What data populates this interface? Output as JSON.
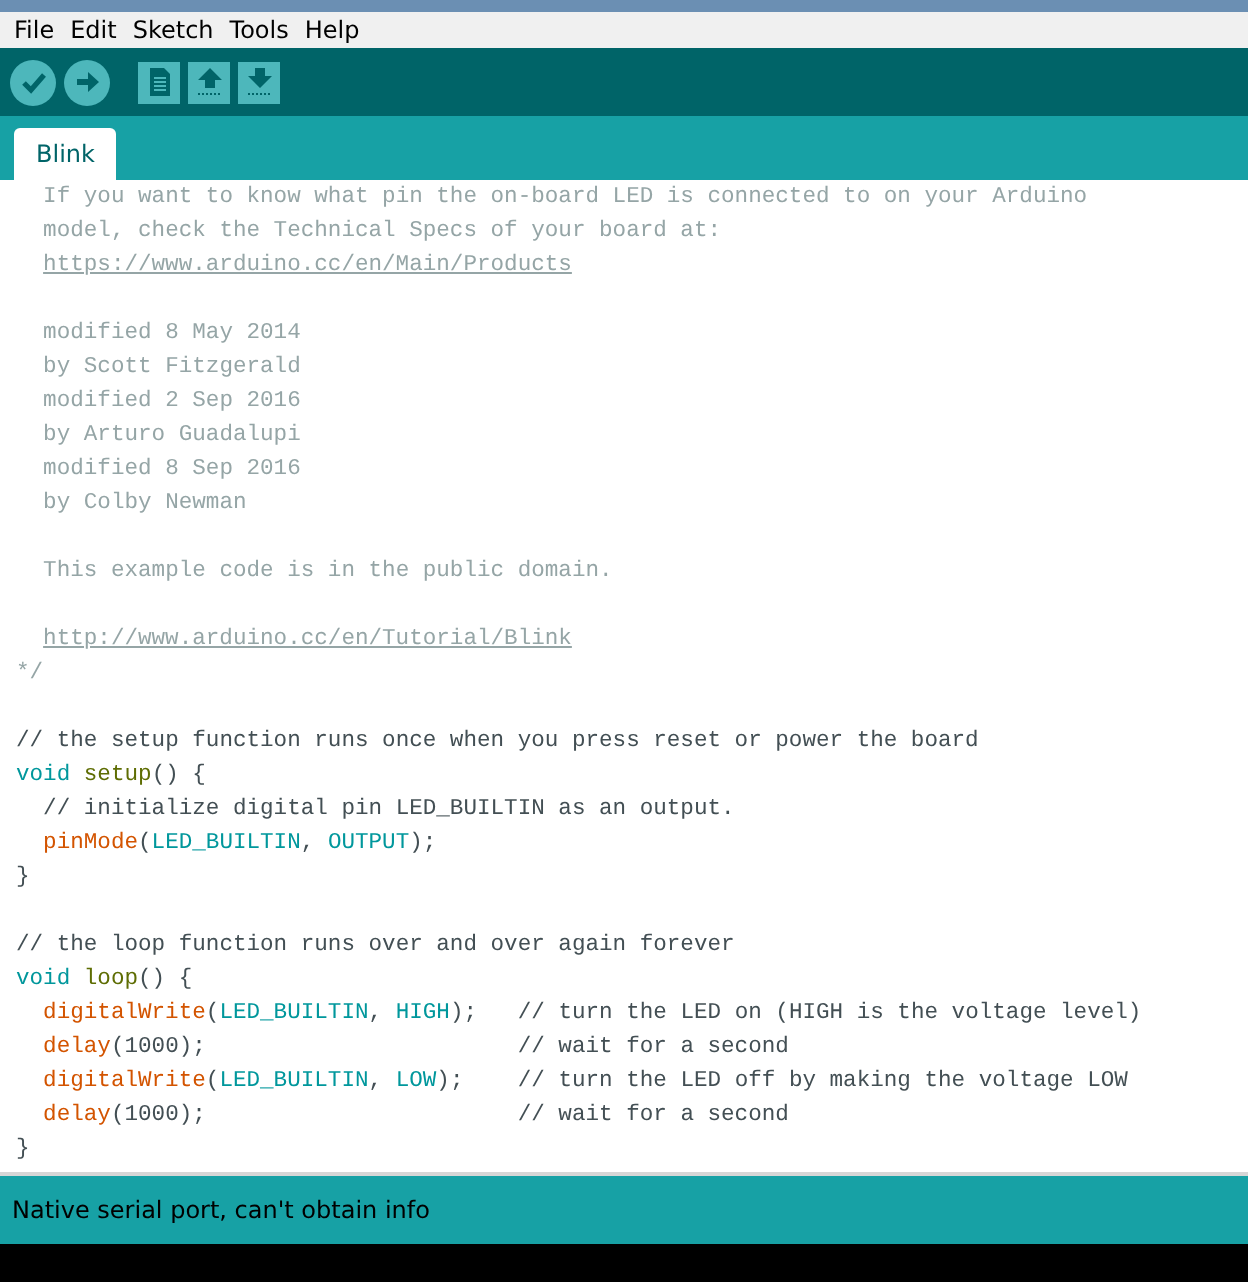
{
  "menu": [
    {
      "label": "File"
    },
    {
      "label": "Edit"
    },
    {
      "label": "Sketch"
    },
    {
      "label": "Tools"
    },
    {
      "label": "Help"
    }
  ],
  "toolbar": [
    {
      "kind": "verify"
    },
    {
      "kind": "upload"
    },
    {
      "kind": "new"
    },
    {
      "kind": "open"
    },
    {
      "kind": "save"
    }
  ],
  "tabs": [
    {
      "label": "Blink",
      "selected": true
    }
  ],
  "editor": {
    "lines": [
      {
        "kind": "code",
        "indented": false,
        "tokens": [
          {
            "kind": "doc-comment",
            "text": "  If you want to know what pin the on-board LED is connected to on your Arduino"
          }
        ]
      },
      {
        "kind": "code",
        "indented": false,
        "tokens": [
          {
            "kind": "doc-comment",
            "text": "  model, check the Technical Specs of your board at:"
          }
        ]
      },
      {
        "kind": "code",
        "indented": true,
        "tokens": [
          {
            "kind": "link",
            "text": "https://www.arduino.cc/en/Main/Products"
          }
        ]
      },
      {
        "kind": "blank"
      },
      {
        "kind": "code",
        "indented": false,
        "tokens": [
          {
            "kind": "doc-comment",
            "text": "  modified 8 May 2014"
          }
        ]
      },
      {
        "kind": "code",
        "indented": false,
        "tokens": [
          {
            "kind": "doc-comment",
            "text": "  by Scott Fitzgerald"
          }
        ]
      },
      {
        "kind": "code",
        "indented": false,
        "tokens": [
          {
            "kind": "doc-comment",
            "text": "  modified 2 Sep 2016"
          }
        ]
      },
      {
        "kind": "code",
        "indented": false,
        "tokens": [
          {
            "kind": "doc-comment",
            "text": "  by Arturo Guadalupi"
          }
        ]
      },
      {
        "kind": "code",
        "indented": false,
        "tokens": [
          {
            "kind": "doc-comment",
            "text": "  modified 8 Sep 2016"
          }
        ]
      },
      {
        "kind": "code",
        "indented": false,
        "tokens": [
          {
            "kind": "doc-comment",
            "text": "  by Colby Newman"
          }
        ]
      },
      {
        "kind": "blank"
      },
      {
        "kind": "code",
        "indented": false,
        "tokens": [
          {
            "kind": "doc-comment",
            "text": "  This example code is in the public domain."
          }
        ]
      },
      {
        "kind": "blank"
      },
      {
        "kind": "code",
        "indented": true,
        "tokens": [
          {
            "kind": "link",
            "text": "http://www.arduino.cc/en/Tutorial/Blink"
          }
        ]
      },
      {
        "kind": "code",
        "indented": false,
        "tokens": [
          {
            "kind": "doc-comment",
            "text": "*/"
          }
        ]
      },
      {
        "kind": "blank"
      },
      {
        "kind": "code",
        "indented": false,
        "tokens": [
          {
            "kind": "comment",
            "text": "// the setup function runs once when you press reset or power the board"
          }
        ]
      },
      {
        "kind": "code",
        "indented": false,
        "tokens": [
          {
            "kind": "keyword",
            "text": "void "
          },
          {
            "kind": "name",
            "text": "setup"
          },
          {
            "kind": "plain",
            "text": "() {"
          }
        ]
      },
      {
        "kind": "code",
        "indented": false,
        "tokens": [
          {
            "kind": "comment",
            "text": "  // initialize digital pin LED_BUILTIN as an output."
          }
        ]
      },
      {
        "kind": "code",
        "indented": true,
        "tokens": [
          {
            "kind": "function",
            "text": "pinMode"
          },
          {
            "kind": "plain",
            "text": "("
          },
          {
            "kind": "constant",
            "text": "LED_BUILTIN"
          },
          {
            "kind": "plain",
            "text": ", "
          },
          {
            "kind": "constant",
            "text": "OUTPUT"
          },
          {
            "kind": "plain",
            "text": ");"
          }
        ]
      },
      {
        "kind": "code",
        "indented": false,
        "tokens": [
          {
            "kind": "plain",
            "text": "}"
          }
        ]
      },
      {
        "kind": "blank"
      },
      {
        "kind": "code",
        "indented": false,
        "tokens": [
          {
            "kind": "comment",
            "text": "// the loop function runs over and over again forever"
          }
        ]
      },
      {
        "kind": "code",
        "indented": false,
        "tokens": [
          {
            "kind": "keyword",
            "text": "void "
          },
          {
            "kind": "name",
            "text": "loop"
          },
          {
            "kind": "plain",
            "text": "() {"
          }
        ]
      },
      {
        "kind": "code",
        "indented": true,
        "tokens": [
          {
            "kind": "function",
            "text": "digitalWrite"
          },
          {
            "kind": "plain",
            "text": "("
          },
          {
            "kind": "constant",
            "text": "LED_BUILTIN"
          },
          {
            "kind": "plain",
            "text": ", "
          },
          {
            "kind": "constant",
            "text": "HIGH"
          },
          {
            "kind": "plain",
            "text": ");   "
          },
          {
            "kind": "comment",
            "text": "// turn the LED on (HIGH is the voltage level)"
          }
        ]
      },
      {
        "kind": "code",
        "indented": true,
        "tokens": [
          {
            "kind": "function",
            "text": "delay"
          },
          {
            "kind": "plain",
            "text": "(1000);                       "
          },
          {
            "kind": "comment",
            "text": "// wait for a second"
          }
        ]
      },
      {
        "kind": "code",
        "indented": true,
        "tokens": [
          {
            "kind": "function",
            "text": "digitalWrite"
          },
          {
            "kind": "plain",
            "text": "("
          },
          {
            "kind": "constant",
            "text": "LED_BUILTIN"
          },
          {
            "kind": "plain",
            "text": ", "
          },
          {
            "kind": "constant",
            "text": "LOW"
          },
          {
            "kind": "plain",
            "text": ");    "
          },
          {
            "kind": "comment",
            "text": "// turn the LED off by making the voltage LOW"
          }
        ]
      },
      {
        "kind": "code",
        "indented": true,
        "tokens": [
          {
            "kind": "function",
            "text": "delay"
          },
          {
            "kind": "plain",
            "text": "(1000);                       "
          },
          {
            "kind": "comment",
            "text": "// wait for a second"
          }
        ]
      },
      {
        "kind": "code",
        "indented": false,
        "tokens": [
          {
            "kind": "plain",
            "text": "}"
          }
        ]
      }
    ]
  },
  "status_bar": {
    "message": "Native serial port, can't obtain info"
  }
}
